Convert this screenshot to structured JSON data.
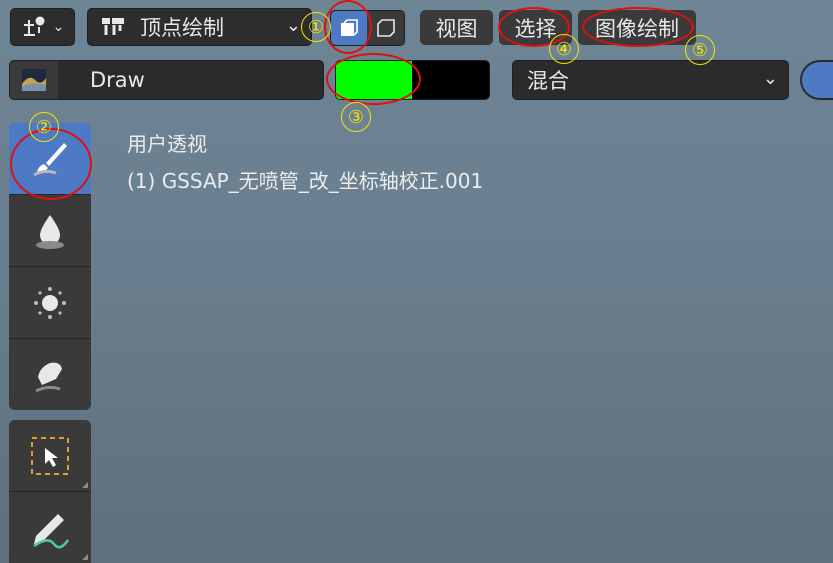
{
  "header": {
    "mode_dropdown_label": "顶点绘制",
    "view_menu": "视图",
    "select_menu": "选择",
    "image_paint_menu": "图像绘制"
  },
  "toolbar2": {
    "brush_name": "Draw",
    "primary_color": "#00ff00",
    "secondary_color": "#000000",
    "blend_mode": "混合"
  },
  "viewport": {
    "view_label": "用户透视",
    "object_label": "(1) GSSAP_无喷管_改_坐标轴校正.001"
  },
  "annotations": [
    "①",
    "②",
    "③",
    "④",
    "⑤"
  ],
  "tools": [
    {
      "icon": "brush-draw-icon",
      "active": true
    },
    {
      "icon": "blur-drop-icon",
      "active": false
    },
    {
      "icon": "average-sparkle-icon",
      "active": false
    },
    {
      "icon": "smear-icon",
      "active": false
    },
    {
      "icon": "box-select-icon",
      "active": false
    },
    {
      "icon": "annotate-pen-icon",
      "active": false
    }
  ]
}
